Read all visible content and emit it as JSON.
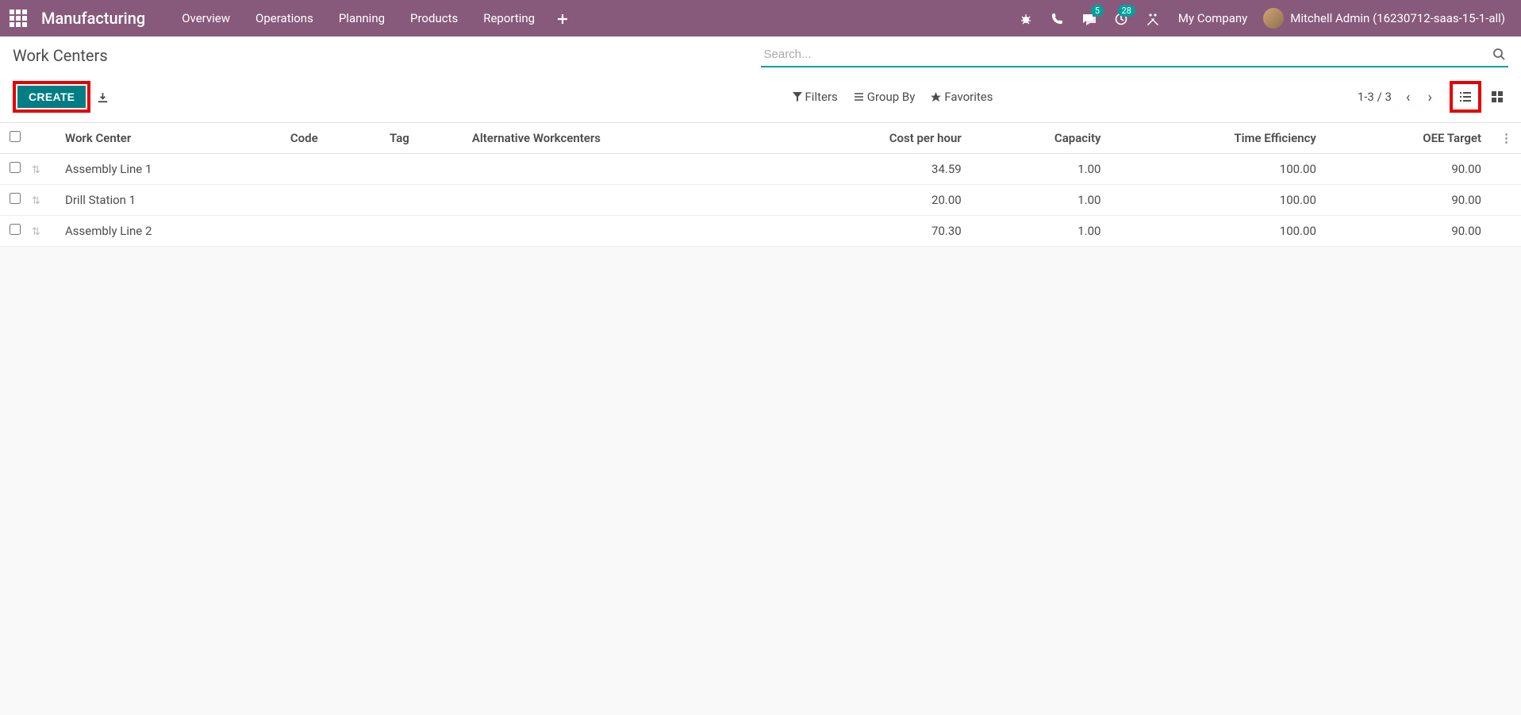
{
  "nav": {
    "app_title": "Manufacturing",
    "menu": [
      "Overview",
      "Operations",
      "Planning",
      "Products",
      "Reporting"
    ],
    "messages_badge": "5",
    "activities_badge": "28",
    "company": "My Company",
    "user": "Mitchell Admin (16230712-saas-15-1-all)"
  },
  "breadcrumb": "Work Centers",
  "search": {
    "placeholder": "Search..."
  },
  "buttons": {
    "create": "CREATE"
  },
  "filters": {
    "filters": "Filters",
    "group_by": "Group By",
    "favorites": "Favorites"
  },
  "pager": {
    "text": "1-3 / 3"
  },
  "columns": {
    "work_center": "Work Center",
    "code": "Code",
    "tag": "Tag",
    "alt": "Alternative Workcenters",
    "cost": "Cost per hour",
    "capacity": "Capacity",
    "time_eff": "Time Efficiency",
    "oee": "OEE Target"
  },
  "rows": [
    {
      "name": "Assembly Line 1",
      "code": "",
      "tag": "",
      "alt": "",
      "cost": "34.59",
      "capacity": "1.00",
      "time_eff": "100.00",
      "oee": "90.00"
    },
    {
      "name": "Drill Station 1",
      "code": "",
      "tag": "",
      "alt": "",
      "cost": "20.00",
      "capacity": "1.00",
      "time_eff": "100.00",
      "oee": "90.00"
    },
    {
      "name": "Assembly Line 2",
      "code": "",
      "tag": "",
      "alt": "",
      "cost": "70.30",
      "capacity": "1.00",
      "time_eff": "100.00",
      "oee": "90.00"
    }
  ]
}
